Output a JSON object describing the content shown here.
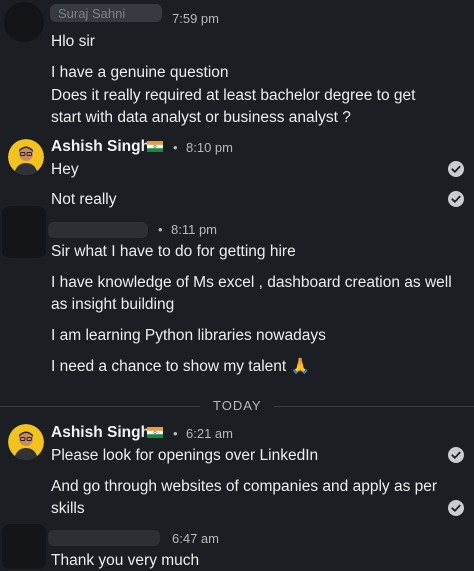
{
  "messages": {
    "m1": {
      "sender": "Suraj Sahni",
      "time": "7:59 pm",
      "lines": [
        "Hlo sir",
        "I have a genuine question",
        "Does it really required at least bachelor degree to get",
        "start with data analyst or business analyst ?"
      ]
    },
    "m2": {
      "sender": "Ashish Singh",
      "flag": "🇮🇳",
      "time": "8:10 pm",
      "lines": [
        "Hey",
        "Not really"
      ]
    },
    "m3": {
      "time": "8:11 pm",
      "lines": [
        "Sir what I have to do for getting hire",
        "I have knowledge of Ms excel , dashboard creation as well",
        "as insight building",
        "I am learning Python libraries nowadays",
        "I need a chance to show my talent 🙏"
      ]
    },
    "divider": "TODAY",
    "m4": {
      "sender": "Ashish Singh",
      "flag": "🇮🇳",
      "time": "6:21 am",
      "lines": [
        "Please look for openings over LinkedIn",
        "And go through websites of companies and apply as per",
        "skills"
      ]
    },
    "m5": {
      "time": "6:47 am",
      "lines": [
        "Thank you very much"
      ]
    },
    "separator": "•",
    "icons": {
      "read_receipt": "check-circle-icon",
      "avatar": "person-avatar"
    },
    "colors": {
      "background": "#1b1f23",
      "text": "#eceef0",
      "muted": "#b6bac0"
    }
  }
}
